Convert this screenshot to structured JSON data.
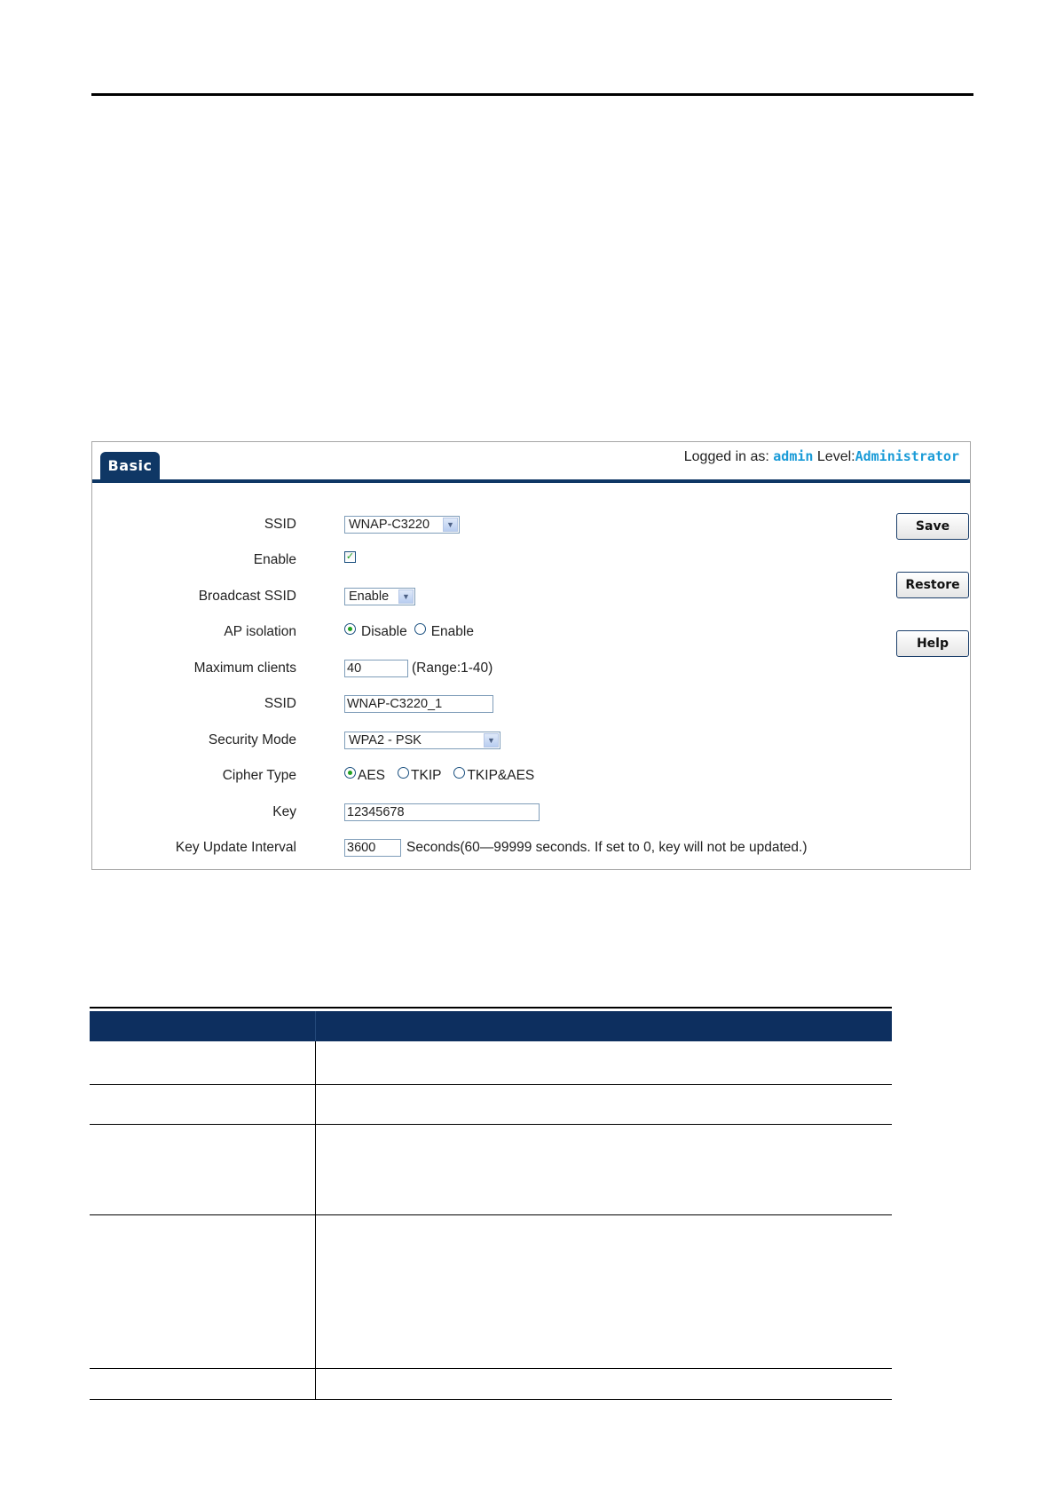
{
  "ui": {
    "tab": "Basic",
    "login": {
      "prefix": "Logged in as:",
      "user": "admin",
      "level_prefix": "Level:",
      "level": "Administrator"
    },
    "fields": {
      "ssid_select": {
        "label": "SSID",
        "value": "WNAP-C3220"
      },
      "enable": {
        "label": "Enable",
        "checked": true
      },
      "broadcast_ssid": {
        "label": "Broadcast SSID",
        "value": "Enable"
      },
      "ap_isolation": {
        "label": "AP isolation",
        "options": [
          "Disable",
          "Enable"
        ],
        "selected": "Disable"
      },
      "max_clients": {
        "label": "Maximum clients",
        "value": "40",
        "hint": "(Range:1-40)"
      },
      "ssid_text": {
        "label": "SSID",
        "value": "WNAP-C3220_1"
      },
      "security_mode": {
        "label": "Security Mode",
        "value": "WPA2 - PSK"
      },
      "cipher_type": {
        "label": "Cipher Type",
        "options": [
          "AES",
          "TKIP",
          "TKIP&AES"
        ],
        "selected": "AES"
      },
      "key": {
        "label": "Key",
        "value": "12345678"
      },
      "key_update_interval": {
        "label": "Key Update Interval",
        "value": "3600",
        "hint": "Seconds(60—99999 seconds. If set to 0, key will not be updated.)"
      }
    },
    "buttons": {
      "save": "Save",
      "restore": "Restore",
      "help": "Help"
    },
    "colors": {
      "tab_blue": "#0f3765",
      "accent_cyan": "#1a9bd7",
      "table_header": "#0d2f5f"
    }
  }
}
